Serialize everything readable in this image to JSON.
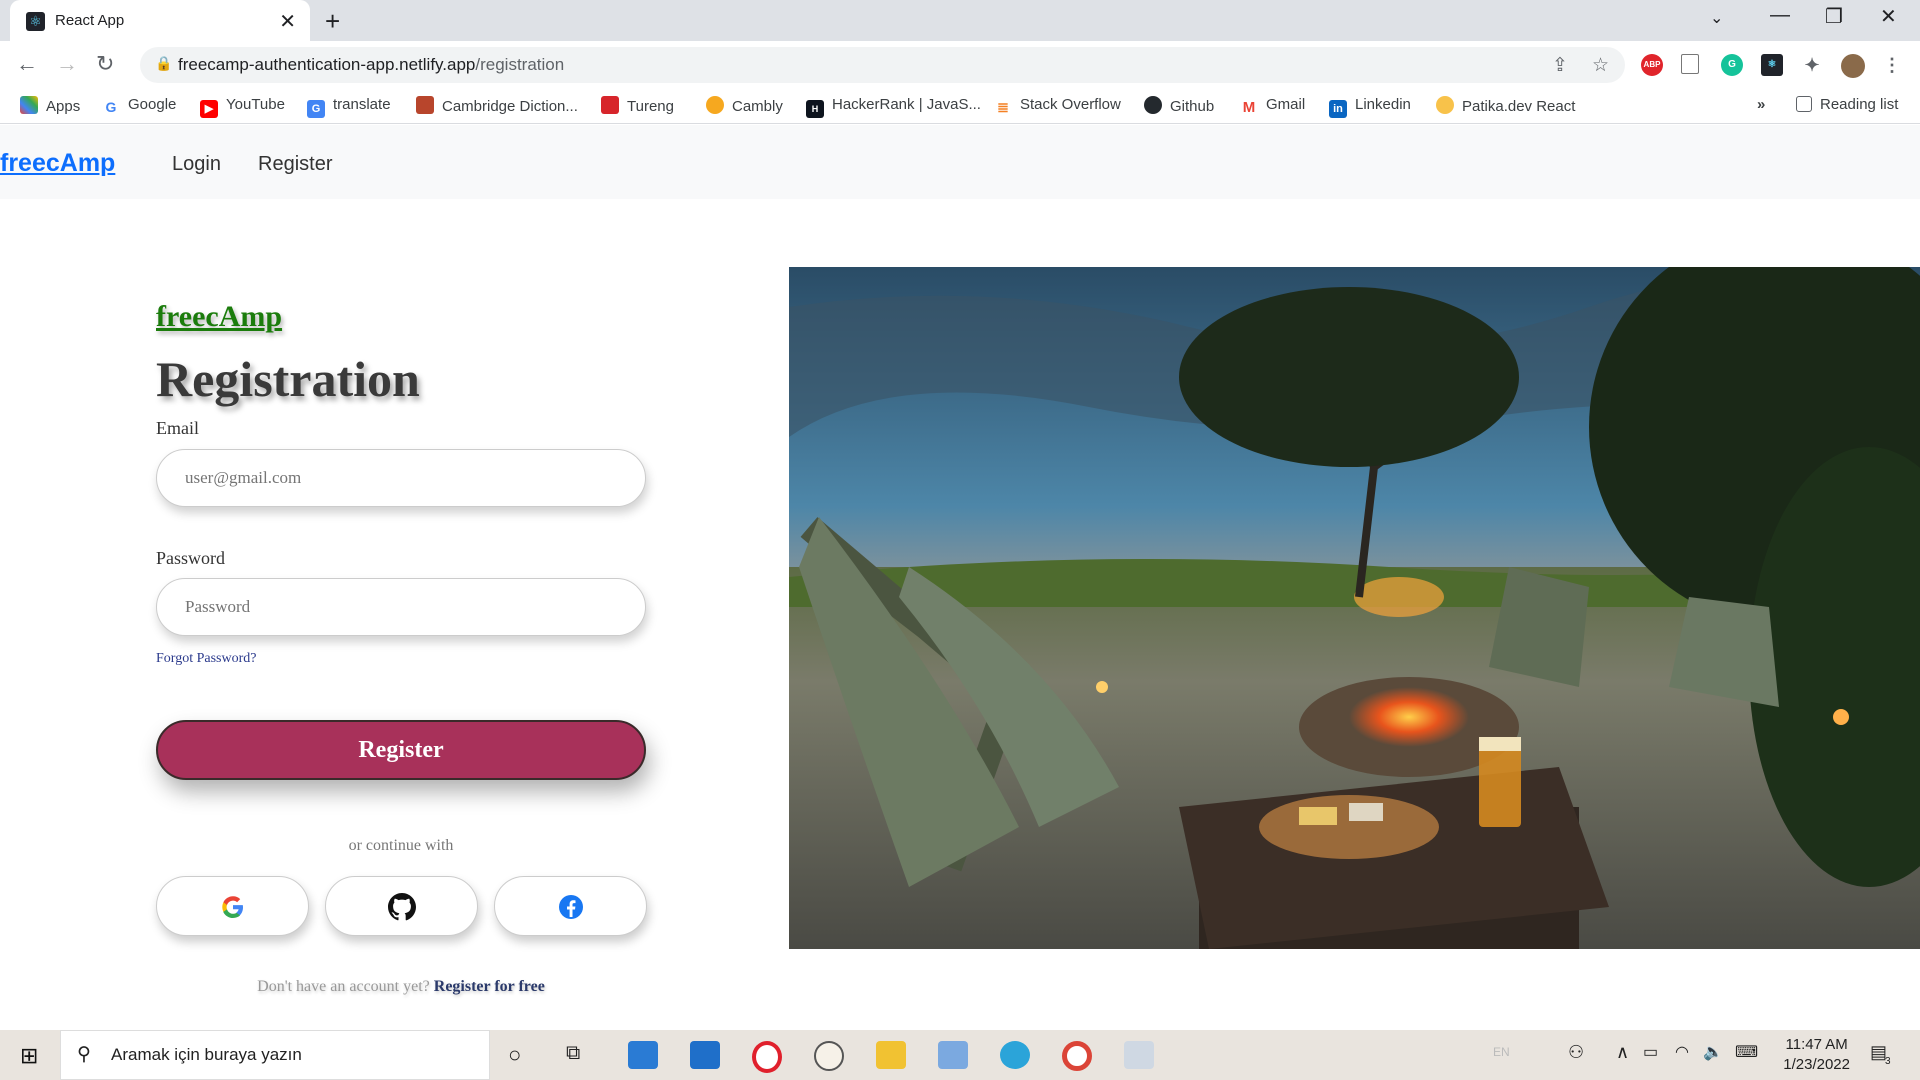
{
  "browser": {
    "tab_title": "React App",
    "url_domain": "freecamp-authentication-app.netlify.app",
    "url_path": "/registration",
    "bookmarks": [
      "Apps",
      "Google",
      "YouTube",
      "translate",
      "Cambridge Diction...",
      "Tureng",
      "Cambly",
      "HackerRank | JavaS...",
      "Stack Overflow",
      "Github",
      "Gmail",
      "Linkedin",
      "Patika.dev React"
    ],
    "overflow": "»",
    "reading_list": "Reading list",
    "extensions": {
      "abp": "ABP"
    }
  },
  "navbar": {
    "brand": "freecAmp",
    "links": [
      "Login",
      "Register"
    ]
  },
  "form": {
    "brand": "freecAmp",
    "title": "Registration",
    "email_label": "Email",
    "email_placeholder": "user@gmail.com",
    "password_label": "Password",
    "password_placeholder": "Password",
    "forgot": "Forgot Password?",
    "submit": "Register",
    "or_continue": "or continue with",
    "social": [
      "google-icon",
      "github-icon",
      "facebook-icon"
    ],
    "no_account": "Don't have an account yet?",
    "register_free": "Register for free"
  },
  "taskbar": {
    "search_placeholder": "Aramak için buraya yazın",
    "lang": "EN",
    "time": "11:47 AM",
    "date": "1/23/2022",
    "notifications": "3"
  },
  "colors": {
    "brand_link": "#0d6efd",
    "form_brand": "#1b7c0c",
    "register_button": "#a8315a"
  }
}
